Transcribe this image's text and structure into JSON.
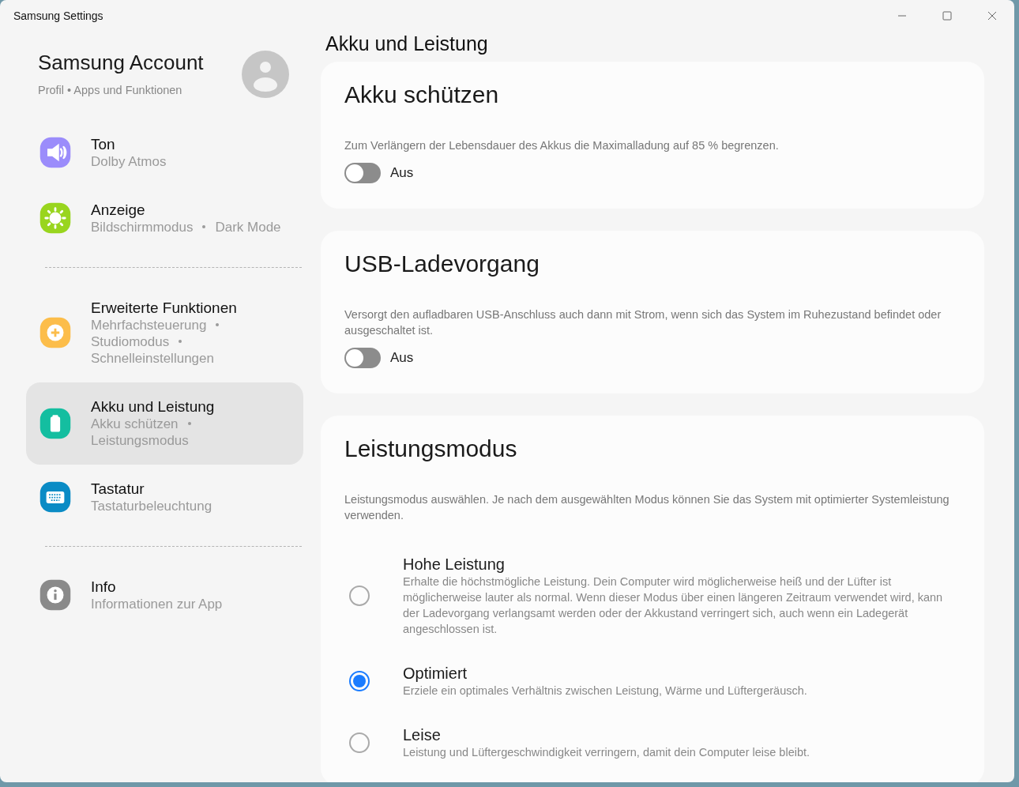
{
  "window": {
    "title": "Samsung Settings"
  },
  "account": {
    "title": "Samsung Account",
    "subtitle": "Profil • Apps und Funktionen"
  },
  "sidebar": {
    "items": [
      {
        "kind": "sound",
        "title": "Ton",
        "details": [
          "Dolby Atmos"
        ],
        "selected": false,
        "color": "#9b8cfb"
      },
      {
        "kind": "display",
        "title": "Anzeige",
        "details": [
          "Bildschirmmodus",
          "Dark Mode"
        ],
        "selected": false,
        "color": "#99d51e"
      },
      {
        "kind": "divider"
      },
      {
        "kind": "advanced",
        "title": "Erweiterte Funktionen",
        "details": [
          "Mehrfachsteuerung",
          "Studiomodus",
          "Schnelleinstellungen"
        ],
        "selected": false,
        "color": "#fcbd4a"
      },
      {
        "kind": "battery",
        "title": "Akku und Leistung",
        "details": [
          "Akku schützen",
          "Leistungsmodus"
        ],
        "selected": true,
        "color": "#14bea0"
      },
      {
        "kind": "keyboard",
        "title": "Tastatur",
        "details": [
          "Tastaturbeleuchtung"
        ],
        "selected": false,
        "color": "#0a8bc5"
      },
      {
        "kind": "divider"
      },
      {
        "kind": "info",
        "title": "Info",
        "details": [
          "Informationen zur App"
        ],
        "selected": false,
        "color": "#8a8a8a"
      }
    ]
  },
  "page": {
    "title": "Akku und Leistung",
    "cards": [
      {
        "kind": "toggle",
        "title": "Akku schützen",
        "description": "Zum Verlängern der Lebensdauer des Akkus die Maximalladung auf 85 % begrenzen.",
        "toggle": {
          "on": false,
          "label": "Aus"
        }
      },
      {
        "kind": "toggle",
        "title": "USB-Ladevorgang",
        "description": "Versorgt den aufladbaren USB-Anschluss auch dann mit Strom, wenn sich das System im Ruhezustand befindet oder ausgeschaltet ist.",
        "toggle": {
          "on": false,
          "label": "Aus"
        }
      },
      {
        "kind": "radio",
        "title": "Leistungsmodus",
        "description": "Leistungsmodus auswählen. Je nach dem ausgewählten Modus können Sie das System mit optimierter Systemleistung verwenden.",
        "options": [
          {
            "label": "Hohe Leistung",
            "description": "Erhalte die höchstmögliche Leistung. Dein Computer wird möglicherweise heiß und der Lüfter ist möglicherweise lauter als normal. Wenn dieser Modus über einen längeren Zeitraum verwendet wird, kann der Ladevorgang verlangsamt werden oder der Akkustand verringert sich, auch wenn ein Ladegerät angeschlossen ist.",
            "selected": false
          },
          {
            "label": "Optimiert",
            "description": "Erziele ein optimales Verhältnis zwischen Leistung, Wärme und Lüftergeräusch.",
            "selected": true
          },
          {
            "label": "Leise",
            "description": "Leistung und Lüftergeschwindigkeit verringern, damit dein Computer leise bleibt.",
            "selected": false
          }
        ]
      }
    ]
  }
}
